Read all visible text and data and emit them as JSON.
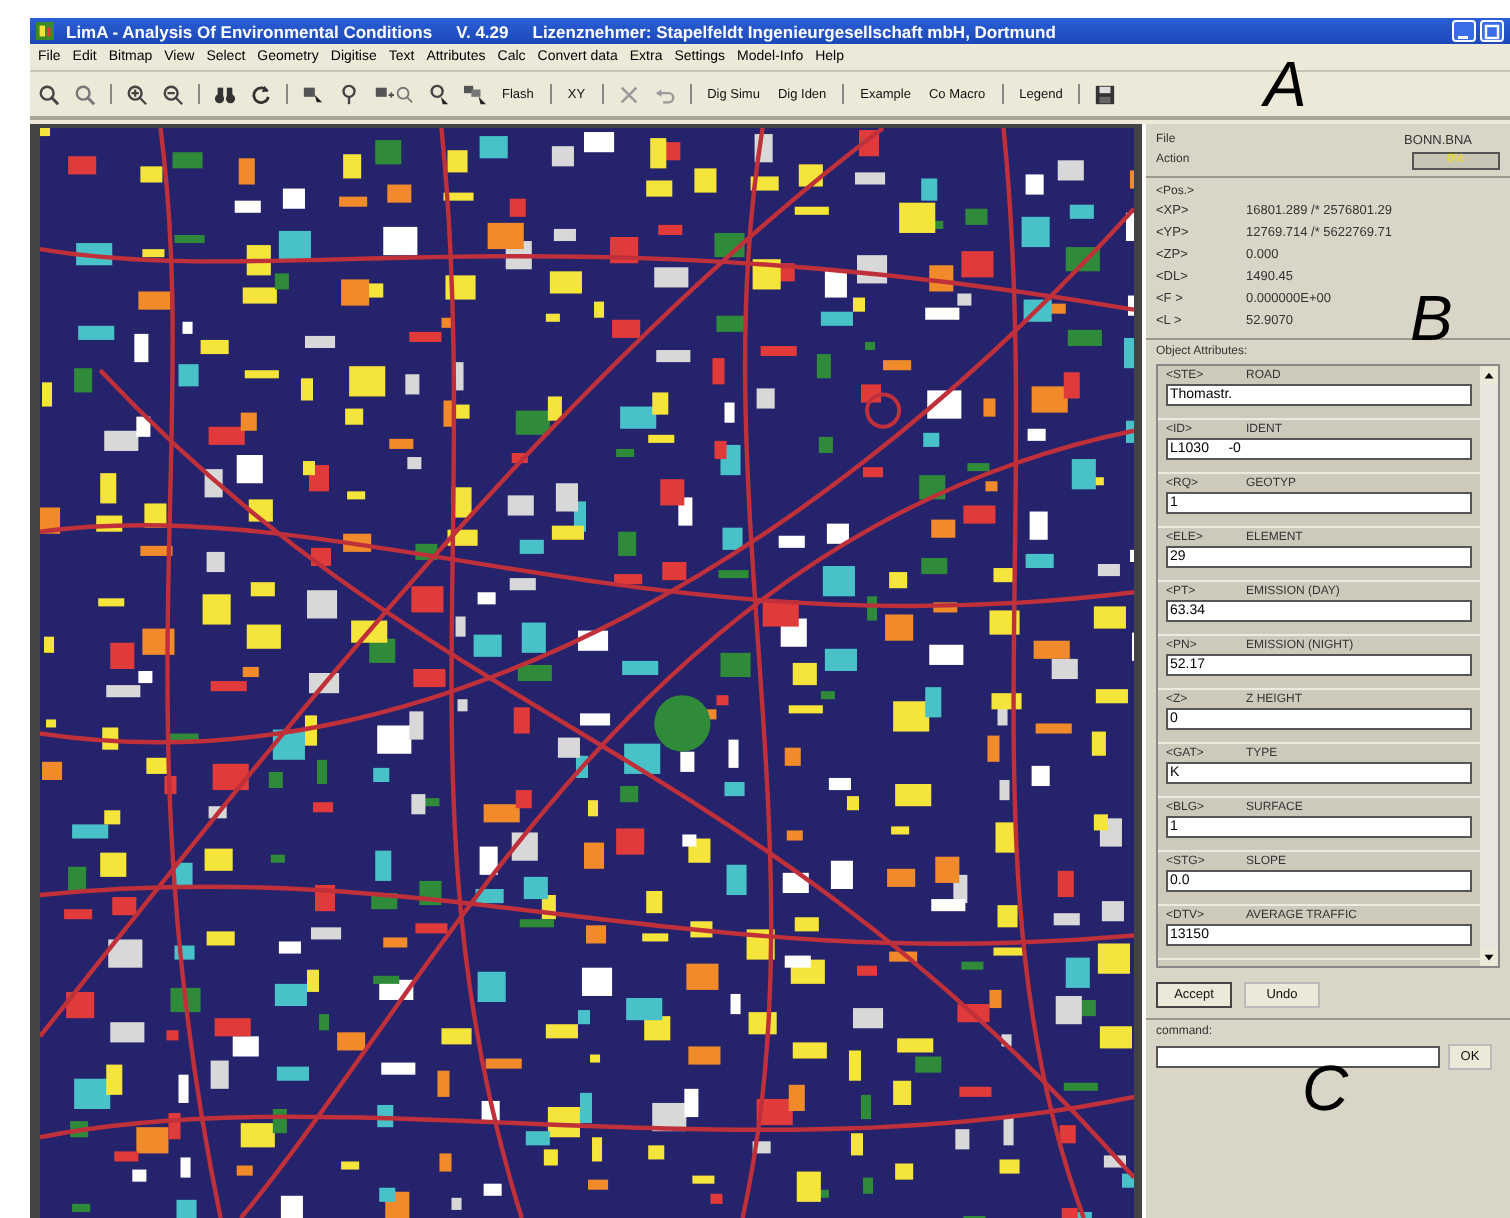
{
  "window": {
    "title": "LimA - Analysis Of Environmental Conditions",
    "version": "V. 4.29",
    "licensee": "Lizenznehmer: Stapelfeldt Ingenieurgesellschaft mbH, Dortmund"
  },
  "menu": [
    "File",
    "Edit",
    "Bitmap",
    "View",
    "Select",
    "Geometry",
    "Digitise",
    "Text",
    "Attributes",
    "Calc",
    "Convert data",
    "Extra",
    "Settings",
    "Model-Info",
    "Help"
  ],
  "toolbar": {
    "buttons": [
      "Flash",
      "XY",
      "Dig Simu",
      "Dig Iden",
      "Example",
      "Co Macro",
      "Legend"
    ]
  },
  "info": {
    "file_label": "File",
    "file_value": "BONN.BNA",
    "action_label": "Action",
    "progress": {
      "level": 0,
      "reading": "0%"
    }
  },
  "position": {
    "heading": "<Pos.>",
    "rows": [
      {
        "key": "<XP>",
        "value": "16801.289 /* 2576801.29"
      },
      {
        "key": "<YP>",
        "value": "12769.714 /* 5622769.71"
      },
      {
        "key": "<ZP>",
        "value": "0.000"
      },
      {
        "key": "<DL>",
        "value": "1490.45"
      },
      {
        "key": "<F >",
        "value": "0.000000E+00"
      },
      {
        "key": "<L >",
        "value": "52.9070"
      }
    ]
  },
  "attributes": {
    "heading": "Object Attributes:",
    "items": [
      {
        "code": "<STE>",
        "name": "ROAD",
        "value": "Thomastr."
      },
      {
        "code": "<ID>",
        "name": "IDENT",
        "value": "L1030     -0"
      },
      {
        "code": "<RQ>",
        "name": "GEOTYP",
        "value": "1"
      },
      {
        "code": "<ELE>",
        "name": "ELEMENT",
        "value": "29"
      },
      {
        "code": "<PT>",
        "name": "EMISSION (DAY)",
        "value": "63.34"
      },
      {
        "code": "<PN>",
        "name": "EMISSION (NIGHT)",
        "value": "52.17"
      },
      {
        "code": "<Z>",
        "name": "Z HEIGHT",
        "value": "0"
      },
      {
        "code": "<GAT>",
        "name": "TYPE",
        "value": "K"
      },
      {
        "code": "<BLG>",
        "name": "SURFACE",
        "value": "1"
      },
      {
        "code": "<STG>",
        "name": "SLOPE",
        "value": "0.0"
      },
      {
        "code": "<DTV>",
        "name": "AVERAGE TRAFFIC",
        "value": "13150"
      }
    ]
  },
  "actions": [
    {
      "label": "Accept",
      "selected": true
    },
    {
      "label": "Undo",
      "selected": false
    }
  ],
  "command": {
    "label": "command:",
    "button": "OK"
  },
  "annotations": [
    "A",
    "B",
    "C"
  ]
}
